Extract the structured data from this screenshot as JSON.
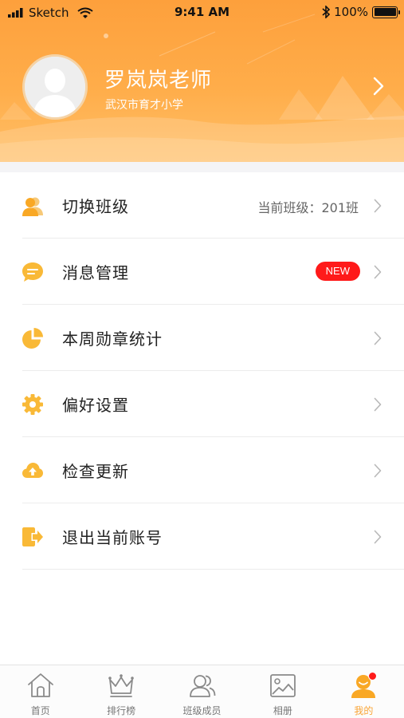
{
  "status_bar": {
    "carrier": "Sketch",
    "time": "9:41 AM",
    "battery": "100%"
  },
  "profile": {
    "name": "罗岚岚老师",
    "school": "武汉市育才小学"
  },
  "menu": {
    "items": [
      {
        "label": "切换班级",
        "icon": "users-icon",
        "value": "当前班级：201班"
      },
      {
        "label": "消息管理",
        "icon": "chat-bubble-icon",
        "badge": "NEW"
      },
      {
        "label": "本周勋章统计",
        "icon": "pie-chart-icon"
      },
      {
        "label": "偏好设置",
        "icon": "gear-icon"
      },
      {
        "label": "检查更新",
        "icon": "cloud-upload-icon"
      },
      {
        "label": "退出当前账号",
        "icon": "logout-icon"
      }
    ]
  },
  "tabbar": {
    "tabs": [
      {
        "label": "首页",
        "icon": "home-icon"
      },
      {
        "label": "排行榜",
        "icon": "crown-icon"
      },
      {
        "label": "班级成员",
        "icon": "members-icon"
      },
      {
        "label": "相册",
        "icon": "album-icon"
      },
      {
        "label": "我的",
        "icon": "profile-icon",
        "active": true
      }
    ]
  },
  "colors": {
    "accent": "#fda03c",
    "badge_red": "#ff1a1a",
    "icon_yellow": "#f9b937",
    "tab_active": "#f9a435"
  }
}
